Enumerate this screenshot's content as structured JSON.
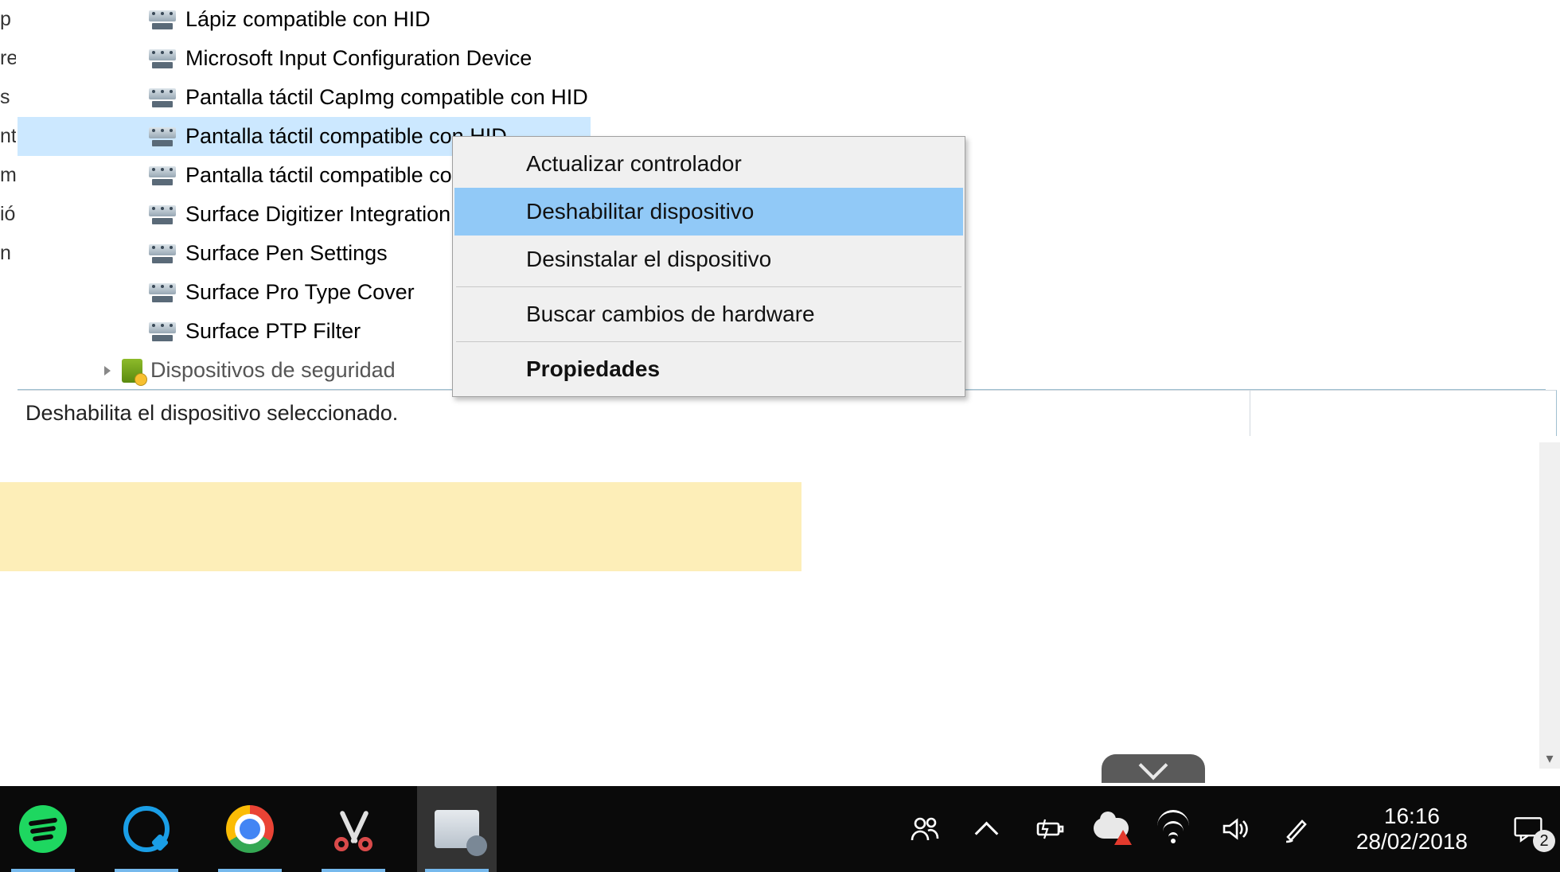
{
  "left_fragments": [
    "p",
    "re",
    "",
    "",
    "s",
    "nt",
    "m",
    "ió",
    "",
    "n"
  ],
  "devices": [
    {
      "label": "Lápiz compatible con HID",
      "selected": false
    },
    {
      "label": "Microsoft Input Configuration Device",
      "selected": false
    },
    {
      "label": "Pantalla táctil CapImg compatible con HID",
      "selected": false
    },
    {
      "label": "Pantalla táctil compatible con HID",
      "selected": true
    },
    {
      "label": "Pantalla táctil compatible con HID",
      "selected": false
    },
    {
      "label": "Surface Digitizer Integration",
      "selected": false
    },
    {
      "label": "Surface Pen Settings",
      "selected": false
    },
    {
      "label": "Surface Pro Type Cover",
      "selected": false
    },
    {
      "label": "Surface PTP Filter",
      "selected": false
    }
  ],
  "next_category": "Dispositivos de seguridad",
  "status_bar": "Deshabilita el dispositivo seleccionado.",
  "context_menu": {
    "update": "Actualizar controlador",
    "disable": "Deshabilitar dispositivo",
    "uninstall": "Desinstalar el dispositivo",
    "scan": "Buscar cambios de hardware",
    "properties": "Propiedades"
  },
  "taskbar": {
    "time": "16:16",
    "date": "28/02/2018",
    "notification_count": "2"
  }
}
